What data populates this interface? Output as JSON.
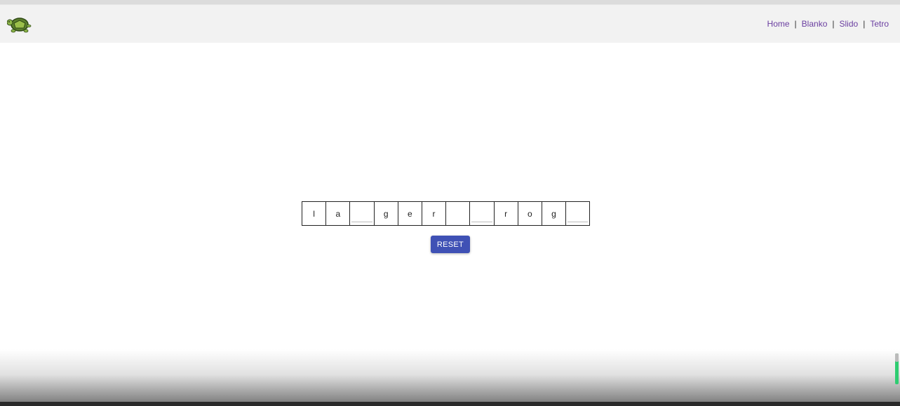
{
  "navbar": {
    "logo_icon": "turtle-icon",
    "links": [
      {
        "label": "Home"
      },
      {
        "label": "Blanko"
      },
      {
        "label": "Slido"
      },
      {
        "label": "Tetro"
      }
    ],
    "separator": "|"
  },
  "game": {
    "tiles": [
      {
        "letter": "l",
        "blank": false
      },
      {
        "letter": "a",
        "blank": false
      },
      {
        "letter": "",
        "blank": true
      },
      {
        "letter": "g",
        "blank": false
      },
      {
        "letter": "e",
        "blank": false
      },
      {
        "letter": "r",
        "blank": false
      },
      {
        "letter": "",
        "blank": false
      },
      {
        "letter": "",
        "blank": true
      },
      {
        "letter": "r",
        "blank": false
      },
      {
        "letter": "o",
        "blank": false
      },
      {
        "letter": "g",
        "blank": false
      },
      {
        "letter": "",
        "blank": true
      }
    ],
    "reset_label": "RESET",
    "accent_color": "#3f51b5"
  }
}
